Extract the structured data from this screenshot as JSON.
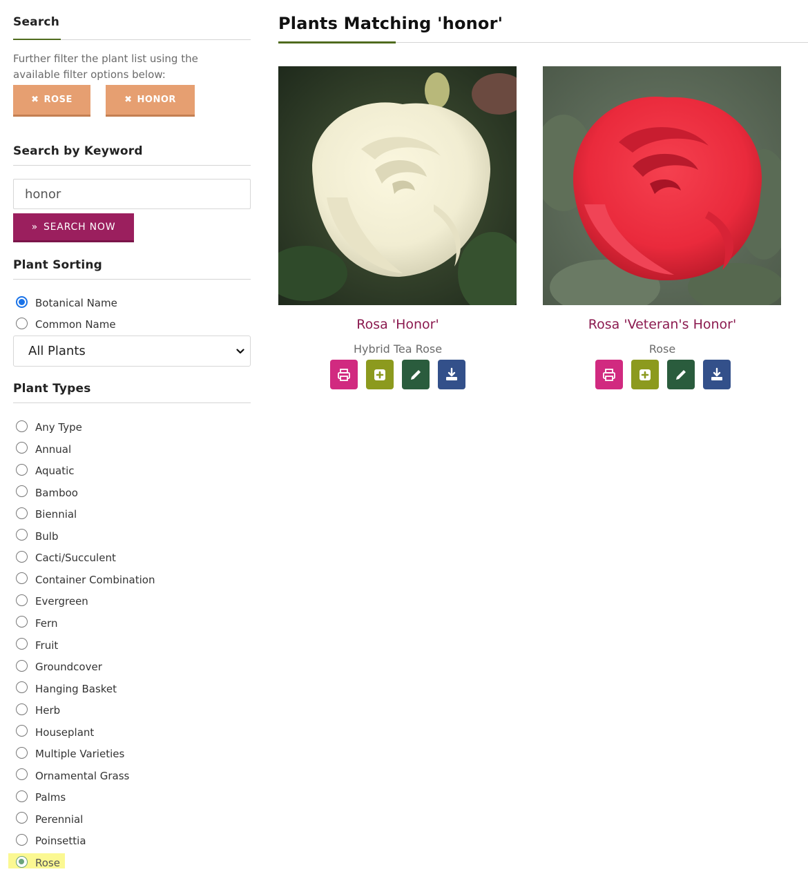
{
  "sidebar": {
    "search_title": "Search",
    "filter_description": "Further filter the plant list using the available filter options below:",
    "active_filters": [
      {
        "label": "ROSE"
      },
      {
        "label": "HONOR"
      }
    ],
    "keyword_title": "Search by Keyword",
    "keyword_value": "honor",
    "search_button": "SEARCH NOW",
    "sorting_title": "Plant Sorting",
    "sort_options": [
      {
        "label": "Botanical Name",
        "checked": true
      },
      {
        "label": "Common Name",
        "checked": false
      }
    ],
    "plants_select": "All Plants",
    "types_title": "Plant Types",
    "plant_types": [
      "Any Type",
      "Annual",
      "Aquatic",
      "Bamboo",
      "Biennial",
      "Bulb",
      "Cacti/Succulent",
      "Container Combination",
      "Evergreen",
      "Fern",
      "Fruit",
      "Groundcover",
      "Hanging Basket",
      "Herb",
      "Houseplant",
      "Multiple Varieties",
      "Ornamental Grass",
      "Palms",
      "Perennial",
      "Poinsettia",
      "Rose"
    ],
    "selected_type": "Rose"
  },
  "main": {
    "title": "Plants Matching 'honor'",
    "results": [
      {
        "botanical_name": "Rosa 'Honor'",
        "common_name": "Hybrid Tea Rose"
      },
      {
        "botanical_name": "Rosa 'Veteran's Honor'",
        "common_name": "Rose"
      }
    ]
  },
  "colors": {
    "accent_green": "#4f6b1d",
    "chip_orange": "#e69f71",
    "search_button": "#9b1f5e",
    "name_link": "#8b1a4f",
    "print": "#d12a80",
    "add": "#8c9a1e",
    "edit": "#2a5c3d",
    "download": "#33508a"
  },
  "icons": [
    "close-icon",
    "double-chevron-right-icon",
    "chevron-down-icon",
    "print-icon",
    "plus-square-icon",
    "pencil-icon",
    "download-icon"
  ]
}
